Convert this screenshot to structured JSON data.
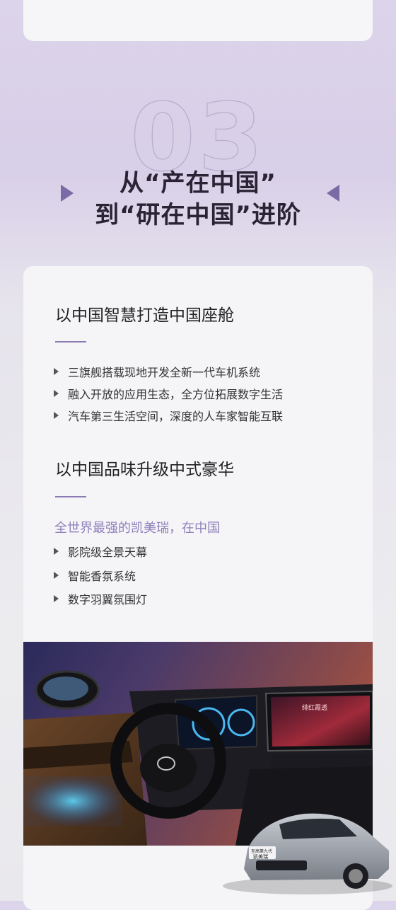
{
  "section_number": "03",
  "heading": {
    "line1": "从“产在中国”",
    "line2": "到“研在中国”进阶"
  },
  "section1": {
    "title": "以中国智慧打造中国座舱",
    "bullets": [
      "三旗舰搭载现地开发全新一代车机系统",
      "融入开放的应用生态，全方位拓展数字生活",
      "汽车第三生活空间，深度的人车家智能互联"
    ]
  },
  "section2": {
    "title": "以中国品味升级中式豪华",
    "subtitle": "全世界最强的凯美瑞，在中国",
    "bullets": [
      "影院级全景天幕",
      "智能香氛系统",
      "数字羽翼氛围灯"
    ]
  },
  "photo": {
    "screen_title": "绯红霞透",
    "car_badge_line1": "至高第九代",
    "car_badge_line2": "凯美瑞"
  }
}
